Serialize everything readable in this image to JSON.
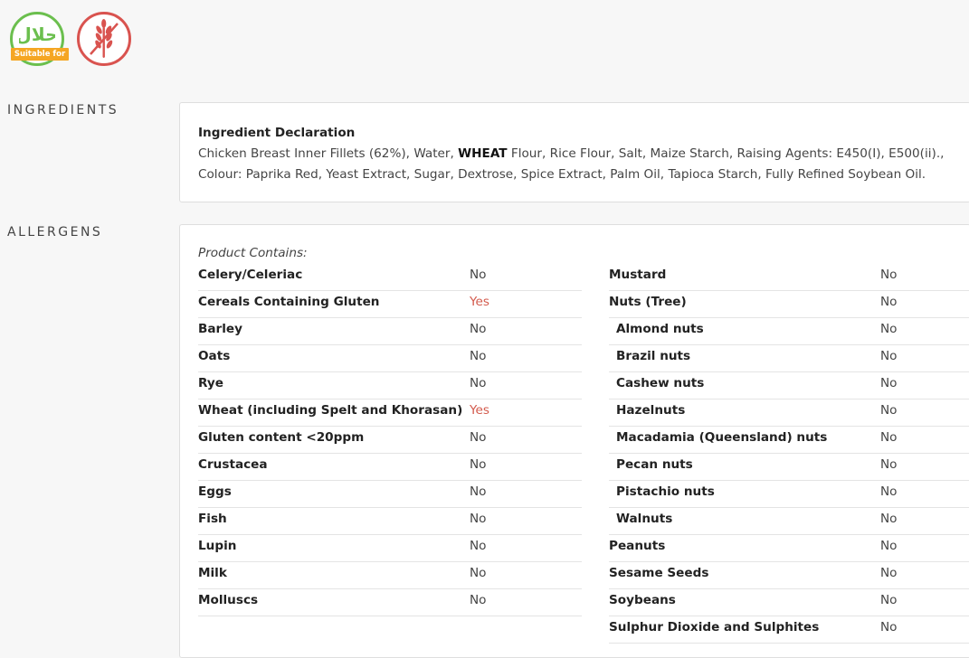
{
  "badges": {
    "halal_script": "حلال",
    "halal_caption": "Suitable for"
  },
  "sections": {
    "ingredients_label": "INGREDIENTS",
    "allergens_label": "ALLERGENS"
  },
  "ingredients": {
    "title": "Ingredient Declaration",
    "text_before": "Chicken Breast Inner Fillets (62%), Water, ",
    "highlight": "WHEAT",
    "text_after": " Flour, Rice Flour, Salt, Maize Starch, Raising Agents: E450(I), E500(ii).,  Colour: Paprika Red, Yeast Extract, Sugar, Dextrose, Spice Extract, Palm Oil, Tapioca Starch, Fully Refined Soybean Oil."
  },
  "allergens": {
    "header": "Product Contains:",
    "left": [
      {
        "name": "Celery/Celeriac",
        "value": "No",
        "sub": false
      },
      {
        "name": "Cereals Containing Gluten",
        "value": "Yes",
        "sub": false
      },
      {
        "name": "Barley",
        "value": "No",
        "sub": false
      },
      {
        "name": "Oats",
        "value": "No",
        "sub": false
      },
      {
        "name": "Rye",
        "value": "No",
        "sub": false
      },
      {
        "name": "Wheat (including Spelt and Khorasan)",
        "value": "Yes",
        "sub": false
      },
      {
        "name": "Gluten content <20ppm",
        "value": "No",
        "sub": false
      },
      {
        "name": "Crustacea",
        "value": "No",
        "sub": false
      },
      {
        "name": "Eggs",
        "value": "No",
        "sub": false
      },
      {
        "name": "Fish",
        "value": "No",
        "sub": false
      },
      {
        "name": "Lupin",
        "value": "No",
        "sub": false
      },
      {
        "name": "Milk",
        "value": "No",
        "sub": false
      },
      {
        "name": "Molluscs",
        "value": "No",
        "sub": false
      }
    ],
    "right": [
      {
        "name": "Mustard",
        "value": "No",
        "sub": false
      },
      {
        "name": "Nuts (Tree)",
        "value": "No",
        "sub": false
      },
      {
        "name": "Almond nuts",
        "value": "No",
        "sub": true
      },
      {
        "name": "Brazil nuts",
        "value": "No",
        "sub": true
      },
      {
        "name": "Cashew nuts",
        "value": "No",
        "sub": true
      },
      {
        "name": "Hazelnuts",
        "value": "No",
        "sub": true
      },
      {
        "name": "Macadamia (Queensland) nuts",
        "value": "No",
        "sub": true
      },
      {
        "name": "Pecan nuts",
        "value": "No",
        "sub": true
      },
      {
        "name": "Pistachio nuts",
        "value": "No",
        "sub": true
      },
      {
        "name": "Walnuts",
        "value": "No",
        "sub": true
      },
      {
        "name": "Peanuts",
        "value": "No",
        "sub": false
      },
      {
        "name": "Sesame Seeds",
        "value": "No",
        "sub": false
      },
      {
        "name": "Soybeans",
        "value": "No",
        "sub": false
      },
      {
        "name": "Sulphur Dioxide and Sulphites",
        "value": "No",
        "sub": false
      }
    ]
  },
  "colors": {
    "halal_green": "#6bbf4e",
    "halal_orange": "#f5a623",
    "gluten_red": "#d9534f",
    "yes_red": "#d35b4d"
  },
  "icons": {
    "halal": "halal-icon",
    "gluten": "wheat-icon"
  }
}
